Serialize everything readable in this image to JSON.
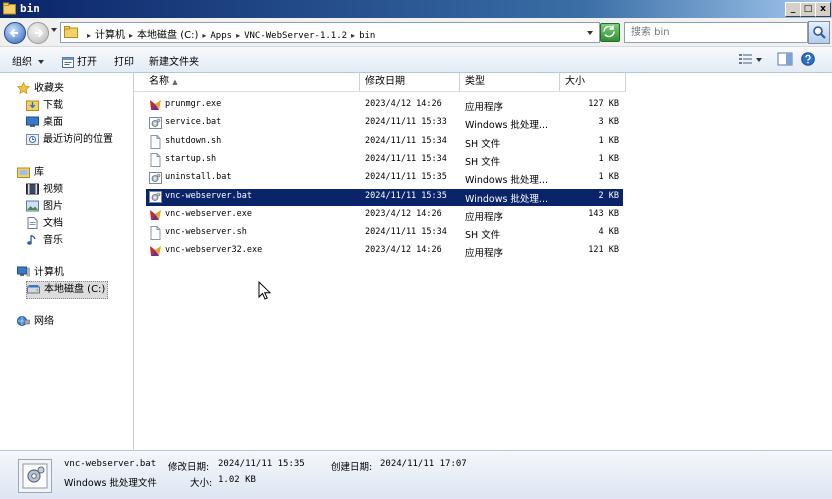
{
  "window": {
    "title": "bin",
    "min_label": "_",
    "max_label": "□",
    "close_label": "x"
  },
  "address": {
    "crumbs": [
      "计算机",
      "本地磁盘 (C:)",
      "Apps",
      "VNC-WebServer-1.1.2",
      "bin"
    ]
  },
  "search": {
    "placeholder": "搜索 bin"
  },
  "toolbar": {
    "organize": "组织",
    "open": "打开",
    "print": "打印",
    "new_folder": "新建文件夹"
  },
  "nav": {
    "favorites": "收藏夹",
    "downloads": "下载",
    "desktop": "桌面",
    "recent": "最近访问的位置",
    "libraries": "库",
    "videos": "视频",
    "pictures": "图片",
    "documents": "文档",
    "music": "音乐",
    "computer": "计算机",
    "local_disk": "本地磁盘 (C:)",
    "network": "网络"
  },
  "columns": {
    "name": "名称",
    "date": "修改日期",
    "type": "类型",
    "size": "大小"
  },
  "files": [
    {
      "name": "prunmgr.exe",
      "date": "2023/4/12 14:26",
      "type": "应用程序",
      "size": "127 KB",
      "icon": "exe-icon"
    },
    {
      "name": "service.bat",
      "date": "2024/11/11 15:33",
      "type": "Windows 批处理...",
      "size": "3 KB",
      "icon": "bat-icon"
    },
    {
      "name": "shutdown.sh",
      "date": "2024/11/11 15:34",
      "type": "SH 文件",
      "size": "1 KB",
      "icon": "file-icon"
    },
    {
      "name": "startup.sh",
      "date": "2024/11/11 15:34",
      "type": "SH 文件",
      "size": "1 KB",
      "icon": "file-icon"
    },
    {
      "name": "uninstall.bat",
      "date": "2024/11/11 15:35",
      "type": "Windows 批处理...",
      "size": "1 KB",
      "icon": "bat-icon"
    },
    {
      "name": "vnc-webserver.bat",
      "date": "2024/11/11 15:35",
      "type": "Windows 批处理...",
      "size": "2 KB",
      "icon": "bat-icon"
    },
    {
      "name": "vnc-webserver.exe",
      "date": "2023/4/12 14:26",
      "type": "应用程序",
      "size": "143 KB",
      "icon": "exe-icon"
    },
    {
      "name": "vnc-webserver.sh",
      "date": "2024/11/11 15:34",
      "type": "SH 文件",
      "size": "4 KB",
      "icon": "file-icon"
    },
    {
      "name": "vnc-webserver32.exe",
      "date": "2023/4/12 14:26",
      "type": "应用程序",
      "size": "121 KB",
      "icon": "exe-icon"
    }
  ],
  "selected_index": 5,
  "details": {
    "filename": "vnc-webserver.bat",
    "modified_label": "修改日期:",
    "modified": "2024/11/11 15:35",
    "created_label": "创建日期:",
    "created": "2024/11/11 17:07",
    "type": "Windows 批处理文件",
    "size_label": "大小:",
    "size": "1.02 KB"
  }
}
